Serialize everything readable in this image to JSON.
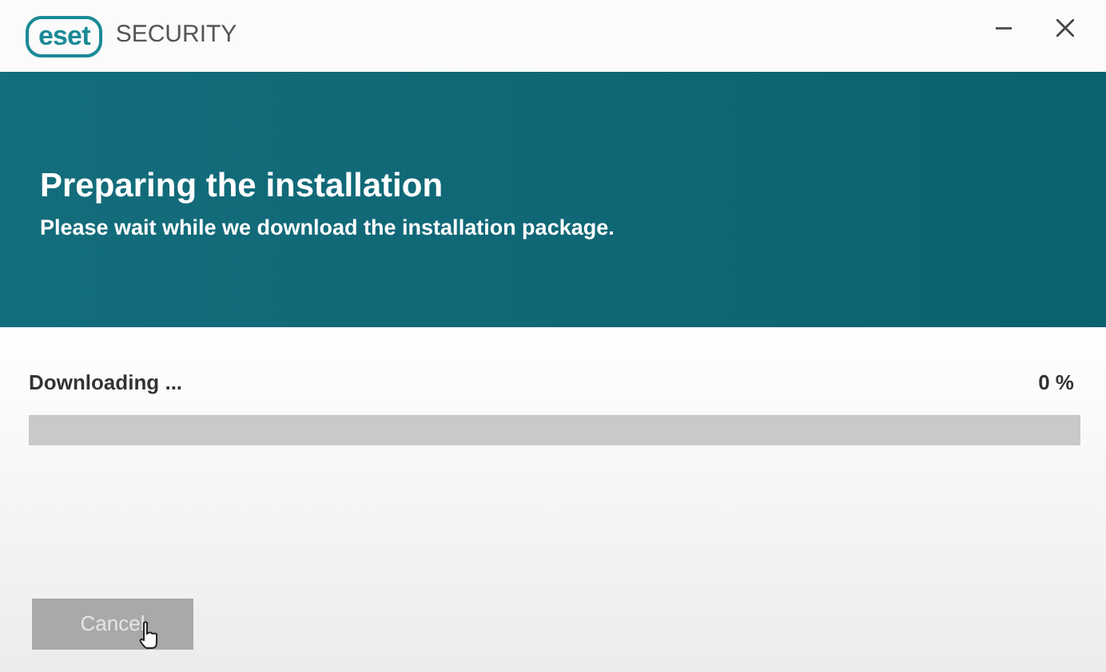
{
  "window": {
    "logo": "eset",
    "title": "SECURITY"
  },
  "banner": {
    "heading": "Preparing the installation",
    "subtitle": "Please wait while we download the installation package."
  },
  "progress": {
    "label": "Downloading ...",
    "reading": "0 %",
    "level": 0
  },
  "buttons": [
    {
      "label": "Cancel",
      "disabled": true
    }
  ]
}
